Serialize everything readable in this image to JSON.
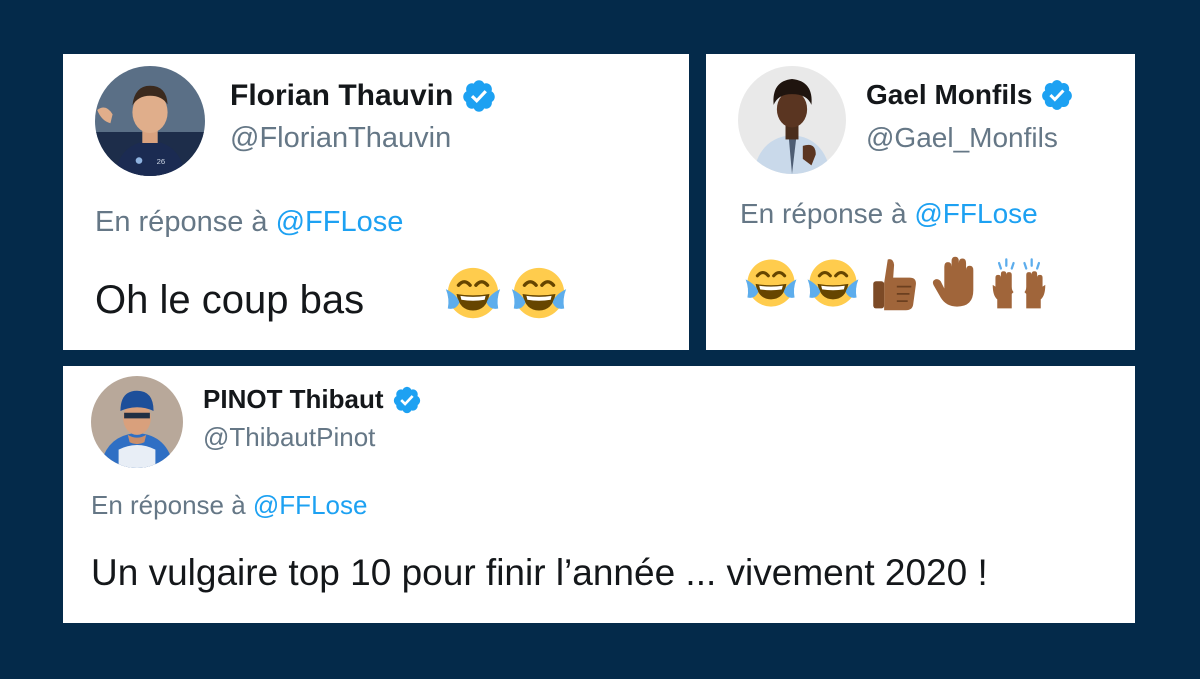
{
  "colors": {
    "background": "#042a4a",
    "card": "#ffffff",
    "text": "#14171a",
    "muted": "#657786",
    "link": "#1da1f2"
  },
  "tweets": [
    {
      "name": "Florian Thauvin",
      "handle": "@FlorianThauvin",
      "verified": true,
      "reply_prefix": "En réponse à",
      "reply_mention": "@FFLose",
      "text": "Oh le coup bas",
      "emojis": [
        "face-with-tears-of-joy",
        "face-with-tears-of-joy"
      ]
    },
    {
      "name": "Gael Monfils",
      "handle": "@Gael_Monfils",
      "verified": true,
      "reply_prefix": "En réponse à",
      "reply_mention": "@FFLose",
      "text": "",
      "emojis": [
        "face-with-tears-of-joy",
        "face-with-tears-of-joy",
        "thumbs-up",
        "raised-hand",
        "raising-hands"
      ]
    },
    {
      "name": "PINOT Thibaut",
      "handle": "@ThibautPinot",
      "verified": true,
      "reply_prefix": "En réponse à",
      "reply_mention": "@FFLose",
      "text": "Un vulgaire top 10 pour finir l’année ... vivement 2020 !",
      "emojis": []
    }
  ]
}
